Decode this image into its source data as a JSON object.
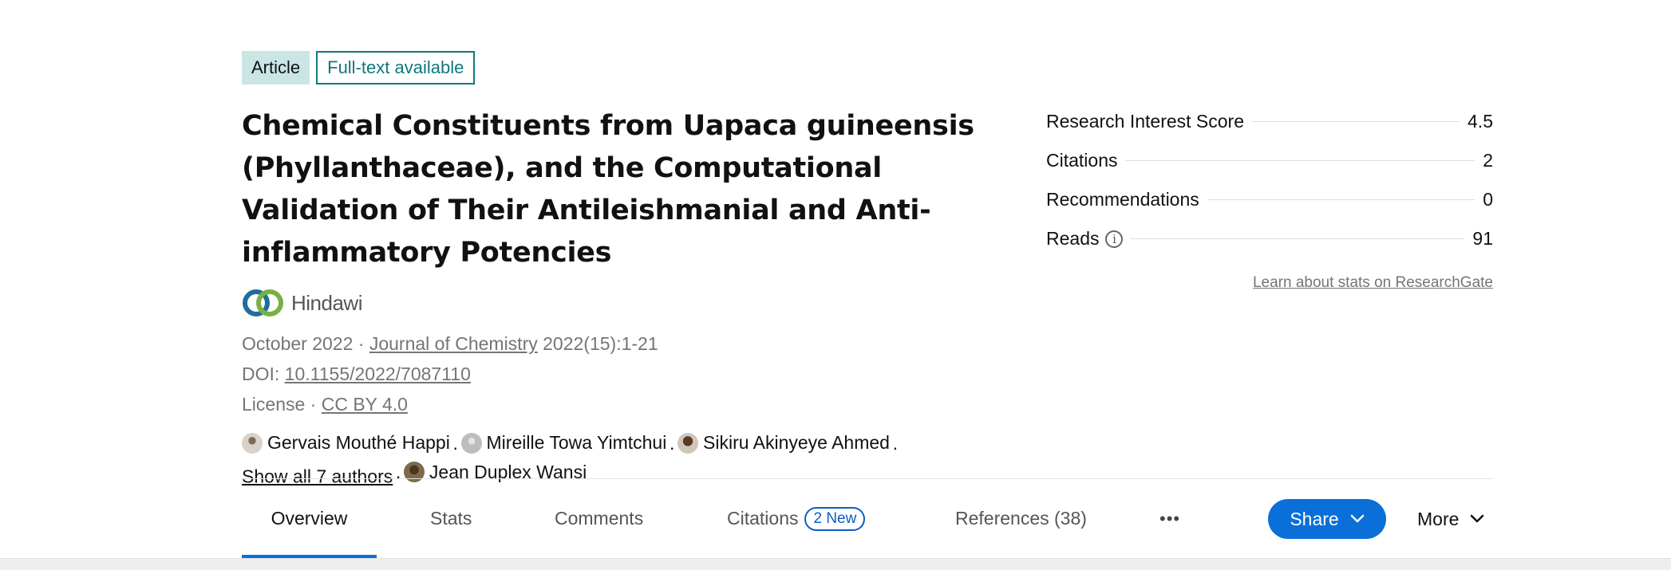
{
  "badges": {
    "article": "Article",
    "fulltext": "Full-text available"
  },
  "title": "Chemical Constituents from Uapaca guineensis (Phyllanthaceae), and the Computational Validation of Their Antileishmanial and Anti-inflammatory Potencies",
  "publisher": {
    "name": "Hindawi",
    "logo_icon": "hindawi-logo-icon",
    "colors": {
      "blue": "#1f6d9c",
      "green": "#79b043"
    }
  },
  "meta": {
    "date": "October 2022",
    "separator": "·",
    "journal": "Journal of Chemistry",
    "volume": "2022(15):1-21",
    "doi_label": "DOI:",
    "doi": "10.1155/2022/7087110",
    "license_label": "License",
    "license": "CC BY 4.0"
  },
  "authors": {
    "list": [
      "Gervais Mouthé Happi",
      "Mireille Towa Yimtchui",
      "Sikiru Akinyeye Ahmed",
      "Jean Duplex Wansi"
    ],
    "show_all": "Show all 7 authors",
    "separator": "·"
  },
  "stats": [
    {
      "label": "Research Interest Score",
      "value": "4.5"
    },
    {
      "label": "Citations",
      "value": "2"
    },
    {
      "label": "Recommendations",
      "value": "0"
    },
    {
      "label": "Reads",
      "value": "91",
      "icon": "info-icon"
    }
  ],
  "stats_info_glyph": "i",
  "learn_link": "Learn about stats on ResearchGate",
  "tabs": {
    "overview": "Overview",
    "stats": "Stats",
    "comments": "Comments",
    "citations": "Citations",
    "citations_badge": "2 New",
    "references": "References (38)",
    "overflow": "•••"
  },
  "actions": {
    "share": "Share",
    "more": "More"
  },
  "colors": {
    "accent": "#0a6fd8",
    "teal": "#10777a",
    "badge_bg": "#c9e6e4"
  }
}
